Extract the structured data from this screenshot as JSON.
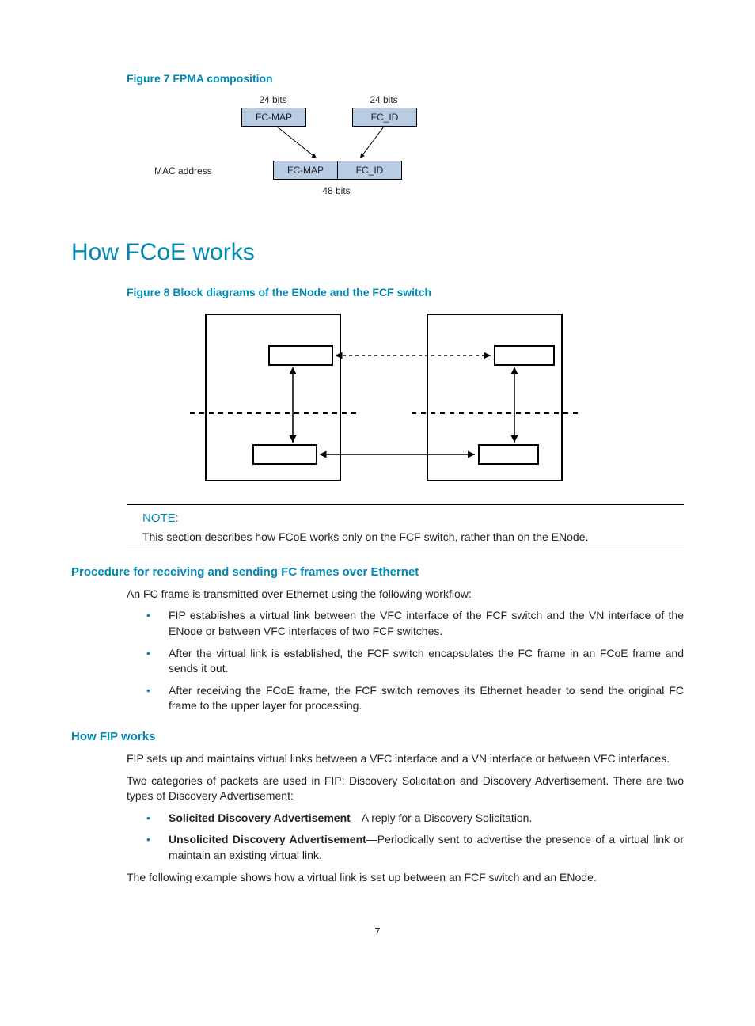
{
  "figure7": {
    "caption": "Figure 7 FPMA composition",
    "bits_top_left": "24 bits",
    "bits_top_right": "24 bits",
    "box_top_left": "FC-MAP",
    "box_top_right": "FC_ID",
    "mac_label": "MAC address",
    "box_bottom_left": "FC-MAP",
    "box_bottom_right": "FC_ID",
    "bits_bottom": "48 bits"
  },
  "section_title": "How FCoE works",
  "figure8": {
    "caption": "Figure 8 Block diagrams of the ENode and the FCF switch"
  },
  "note": {
    "label": "NOTE:",
    "text": "This section describes how FCoE works only on the FCF switch, rather than on the ENode."
  },
  "proc_heading": "Procedure for receiving and sending FC frames over Ethernet",
  "proc_intro": "An FC frame is transmitted over Ethernet using the following workflow:",
  "proc_bullets": [
    "FIP establishes a virtual link between the VFC interface of the FCF switch and the VN interface of the ENode or between VFC interfaces of two FCF switches.",
    "After the virtual link is established, the FCF switch encapsulates the FC frame in an FCoE frame and sends it out.",
    "After receiving the FCoE frame, the FCF switch removes its Ethernet header to send the original FC frame to the upper layer for processing."
  ],
  "fip_heading": "How FIP works",
  "fip_p1": "FIP sets up and maintains virtual links between a VFC interface and a VN interface or between VFC interfaces.",
  "fip_p2": "Two categories of packets are used in FIP: Discovery Solicitation and Discovery Advertisement. There are two types of Discovery Advertisement:",
  "fip_bullets": [
    {
      "bold": "Solicited Discovery Advertisement",
      "text": "—A reply for a Discovery Solicitation."
    },
    {
      "bold": "Unsolicited Discovery Advertisement",
      "text": "—Periodically sent to advertise the presence of a virtual link or maintain an existing virtual link."
    }
  ],
  "fip_p3": "The following example shows how a virtual link is set up between an FCF switch and an ENode.",
  "page_number": "7"
}
